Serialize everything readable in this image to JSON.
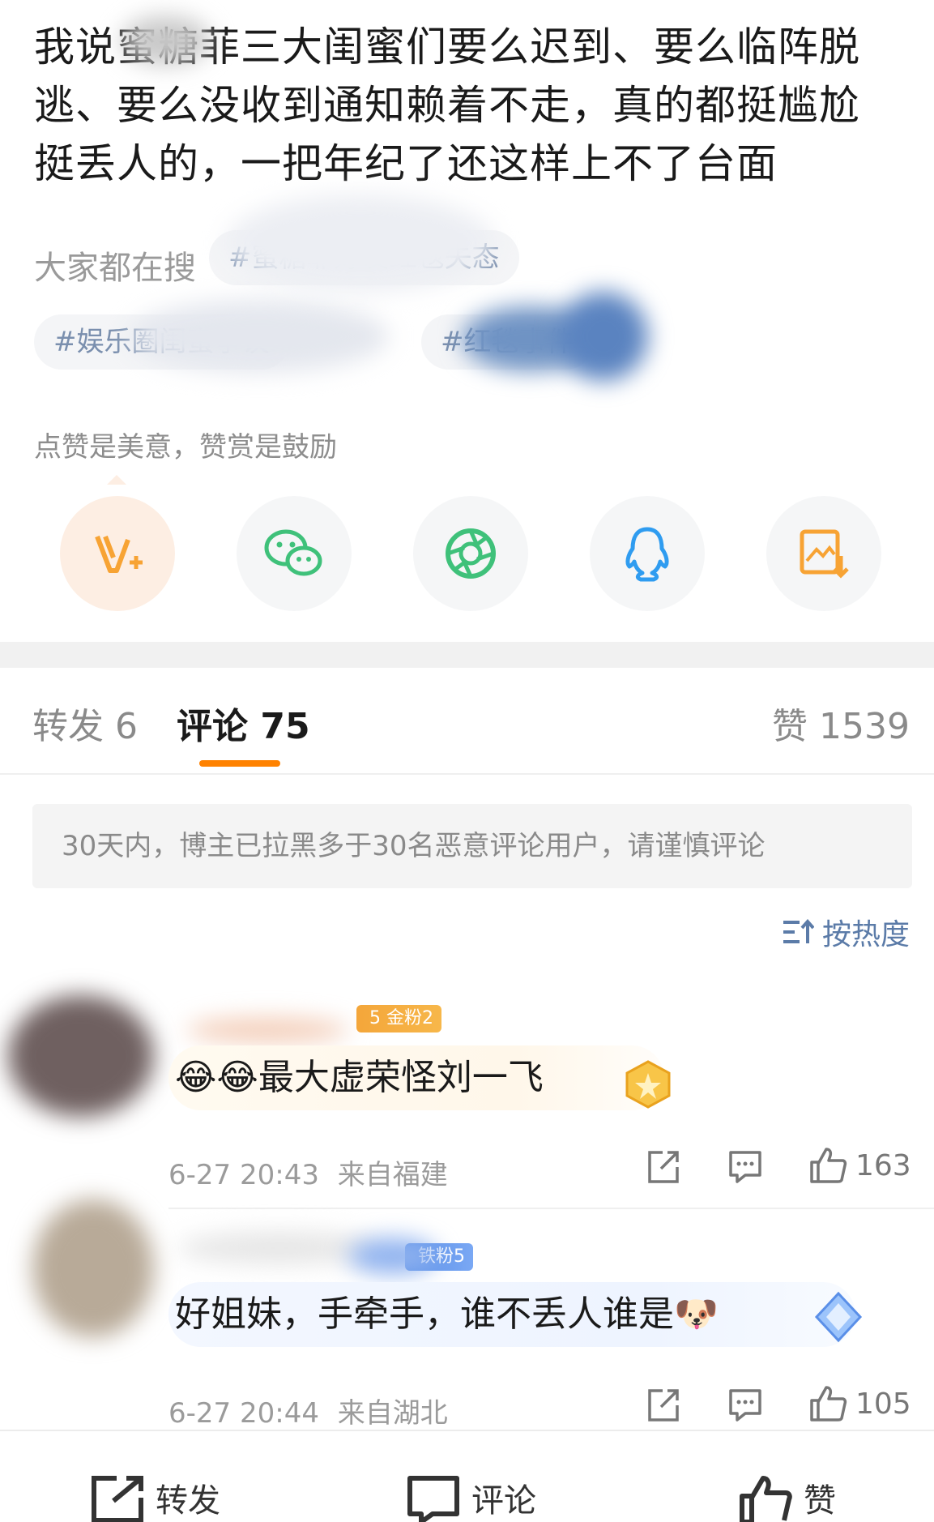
{
  "post": {
    "text": "我说蜜糖菲三大闺蜜们要么迟到、要么临阵脱逃、要么没收到通知赖着不走，真的都挺尴尬挺丢人的，一把年纪了还这样上不了台面"
  },
  "trending": {
    "label": "大家都在搜",
    "pills": [
      "#蜜糖菲好友红毯失态",
      "#娱乐圈闺蜜争议",
      "#红毯事件"
    ]
  },
  "reward": {
    "text": "点赞是美意，赞赏是鼓励"
  },
  "share_buttons": [
    {
      "icon": "v-plus-reward-icon",
      "color": "#f7a334"
    },
    {
      "icon": "wechat-icon",
      "color": "#3fc17a"
    },
    {
      "icon": "moments-icon",
      "color": "#3fc17a"
    },
    {
      "icon": "qq-icon",
      "color": "#2f9cf0"
    },
    {
      "icon": "save-image-icon",
      "color": "#f7a334"
    }
  ],
  "tabs": {
    "repost_label": "转发",
    "repost_count": "6",
    "comment_label": "评论",
    "comment_count": "75",
    "like_label": "赞",
    "like_count": "1539"
  },
  "notice": {
    "text": "30天内，博主已拉黑多于30名恶意评论用户，请谨慎评论"
  },
  "sort": {
    "label": "按热度"
  },
  "comments": [
    {
      "badge": "金粉2",
      "badge_level": "5",
      "text": "😂😂最大虚荣怪刘一飞",
      "time": "6-27 20:43",
      "location": "来自福建",
      "likes": "163"
    },
    {
      "badge": "铁粉5",
      "text": "好姐妹，手牵手，谁不丢人谁是🐶",
      "time": "6-27 20:44",
      "location": "来自湖北",
      "likes": "105"
    }
  ],
  "bottom_bar": {
    "repost": "转发",
    "comment": "评论",
    "like": "赞"
  },
  "colors": {
    "accent": "#ff8200",
    "link": "#5b7ba8"
  }
}
